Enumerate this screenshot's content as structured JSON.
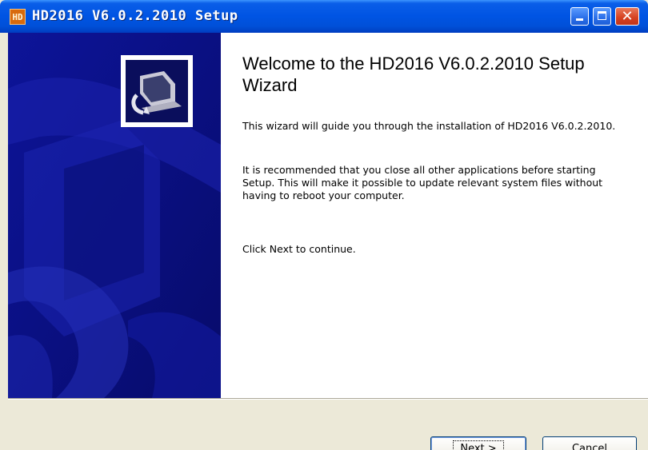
{
  "window": {
    "title": "HD2016 V6.0.2.2010 Setup",
    "app_icon_text": "HD",
    "controls": {
      "minimize_icon": "minimize-icon",
      "maximize_icon": "maximize-icon",
      "close_icon": "close-icon",
      "close_glyph": "✕"
    }
  },
  "wizard": {
    "title": "Welcome to the HD2016 V6.0.2.2010 Setup Wizard",
    "paragraphs": [
      "This wizard will guide you through the installation of HD2016 V6.0.2.2010.",
      "It is recommended that you close all other applications before starting Setup. This will make it possible to update relevant system files without having to reboot your computer.",
      "Click Next to continue."
    ],
    "side_icon": "installer-computer-icon"
  },
  "buttons": {
    "next_prefix": "N",
    "next_rest": "ext >",
    "cancel": "Cancel"
  },
  "colors": {
    "title_bar": "#0054e3",
    "side_panel": "#0b0f86",
    "close_button": "#d5401f",
    "dialog_bg": "#ece9d8"
  }
}
